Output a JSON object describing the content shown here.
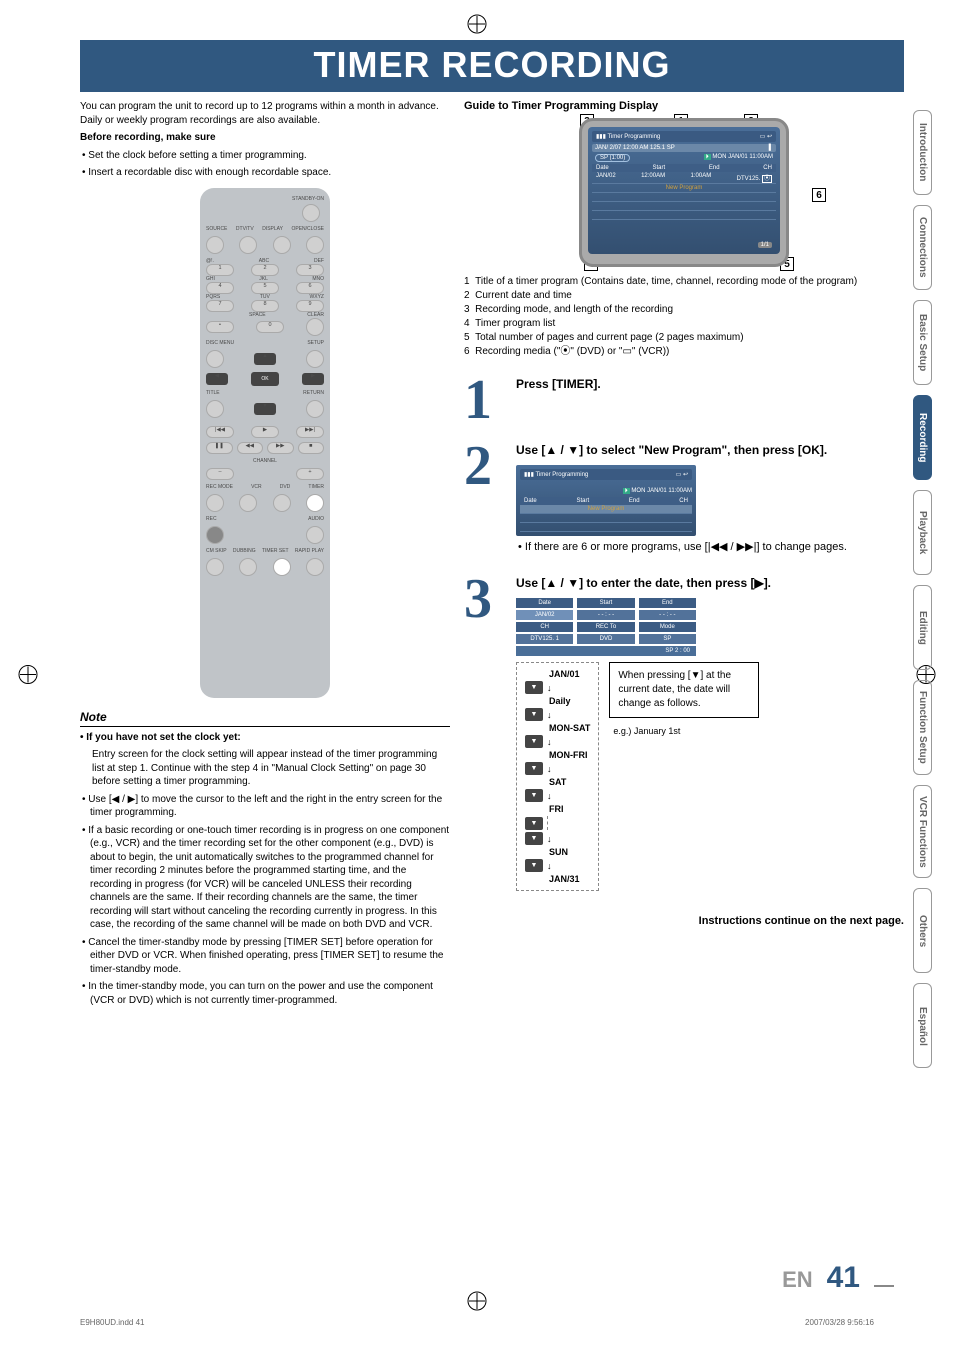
{
  "title": "TIMER RECORDING",
  "intro": "You can program the unit to record up to 12 programs within a month in advance. Daily or weekly program recordings are also available.",
  "before_heading": "Before recording, make sure",
  "before_items": [
    "Set the clock before setting a timer programming.",
    "Insert a recordable disc with enough recordable space."
  ],
  "remote_labels": {
    "standby": "STANDBY-ON",
    "row1": [
      "SOURCE",
      "DTV/TV",
      "DISPLAY",
      "OPEN/CLOSE"
    ],
    "letters": [
      "@!.",
      "ABC",
      "DEF",
      "GHI",
      "JKL",
      "MNO",
      "PQRS",
      "TUV",
      "WXYZ",
      "",
      "SPACE",
      "CLEAR"
    ],
    "disc": "DISC MENU",
    "setup": "SETUP",
    "title": "TITLE",
    "return": "RETURN",
    "ok": "OK",
    "channel": "CHANNEL",
    "recmode": "REC MODE",
    "vcr": "VCR",
    "dvd": "DVD",
    "timer": "TIMER",
    "rec": "REC",
    "audio": "AUDIO",
    "cmskip": "CM SKIP",
    "dubbing": "DUBBING",
    "timerset": "TIMER SET",
    "rapid": "RAPID PLAY"
  },
  "note_title": "Note",
  "note_bold": "If you have not set the clock yet:",
  "note_body": "Entry screen for the clock setting will appear instead of the timer programming list at step 1. Continue with the step 4 in \"Manual Clock Setting\" on page 30 before setting a timer programming.",
  "note_items": [
    "Use [◀ / ▶] to move the cursor to the left and the right in the entry screen for the timer programming.",
    "If a basic recording or one-touch timer recording is in progress on one component (e.g., VCR) and the timer recording set for the other component (e.g., DVD) is about to begin, the unit automatically switches to the programmed channel for timer recording 2 minutes before the programmed starting time, and the recording in progress (for VCR) will be canceled UNLESS their recording channels are the same. If their recording channels are the same, the timer recording will start without canceling the recording currently in progress. In this case, the recording of the same channel will be made on both DVD and VCR.",
    "Cancel the timer-standby mode by pressing [TIMER SET] before operation for either DVD or VCR. When finished operating, press [TIMER SET] to resume the timer-standby mode.",
    "In the timer-standby mode, you can turn on the power and use the component (VCR or DVD) which is not currently timer-programmed."
  ],
  "guide_title": "Guide to Timer Programming Display",
  "tv": {
    "header": "Timer Programming",
    "subhead_left": "JAN/  2/07  12:00 AM 125.1 SP",
    "sp": "SP  (1:00)",
    "clock": "MON JAN/01 11:00AM",
    "cols": [
      "Date",
      "Start",
      "End",
      "CH"
    ],
    "row": [
      "JAN/02",
      "12:00AM",
      "1:00AM",
      "DTV125."
    ],
    "newprog": "New Program",
    "pager": "1/1"
  },
  "legend": [
    "1  Title of a timer program (Contains date, time, channel, recording mode of the program)",
    "2  Current date and time",
    "3  Recording mode, and length of the recording",
    "4  Timer program list",
    "5  Total number of pages and current page (2 pages maximum)",
    "6  Recording media (\"⦿\" (DVD) or \"▭\" (VCR))"
  ],
  "step1": "Press [TIMER].",
  "step2_head": "Use [▲ / ▼] to select \"New Program\", then press [OK].",
  "step2_hint": "If there are 6 or more programs, use [|◀◀ / ▶▶|] to change pages.",
  "step2_tv": {
    "header": "Timer Programming",
    "clock": "MON JAN/01 11:00AM",
    "cols": [
      "Date",
      "Start",
      "End",
      "CH"
    ],
    "newprog": "New Program"
  },
  "step3_head": "Use [▲ / ▼] to enter the date, then press [▶].",
  "step3_table": {
    "h": [
      "Date",
      "Start",
      "End"
    ],
    "r1": [
      "JAN/02",
      "- - : - -",
      "- - : - -"
    ],
    "h2": [
      "CH",
      "REC To",
      "Mode"
    ],
    "r2": [
      "DTV125. 1",
      "DVD",
      "SP"
    ],
    "bottom": "SP      2 : 00"
  },
  "date_list": [
    "JAN/01",
    "Daily",
    "MON-SAT",
    "MON-FRI",
    "SAT",
    "FRI",
    "SUN",
    "JAN/31"
  ],
  "press_box": [
    "When pressing [▼] at the current date, the date will change as follows.",
    "e.g.) January 1st"
  ],
  "continue": "Instructions continue on the next page.",
  "side_tabs": [
    "Introduction",
    "Connections",
    "Basic Setup",
    "Recording",
    "Playback",
    "Editing",
    "Function Setup",
    "VCR Functions",
    "Others",
    "Español"
  ],
  "active_tab_index": 3,
  "footer_lang": "EN",
  "footer_page": "41",
  "file_footer_left": "E9H80UD.indd   41",
  "file_footer_right": "2007/03/28   9:56:16"
}
